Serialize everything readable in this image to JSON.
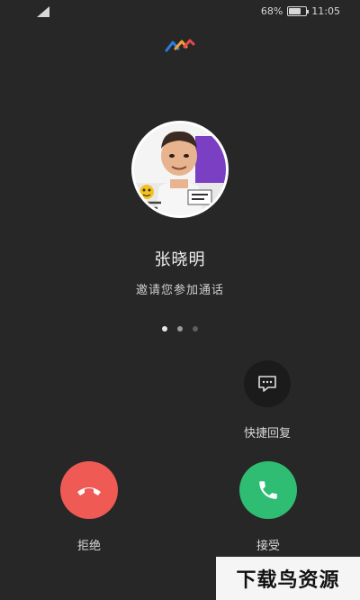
{
  "status_bar": {
    "battery_percent": "68%",
    "battery_level": 0.68,
    "time": "11:05"
  },
  "caller": {
    "name": "张晓明",
    "subtitle": "邀请您参加通话"
  },
  "pager": {
    "count": 3,
    "active_index": 0
  },
  "quick_reply": {
    "label": "快捷回复",
    "icon": "message-icon"
  },
  "actions": {
    "decline_label": "拒绝",
    "accept_label": "接受"
  },
  "watermark": {
    "text": "下载鸟资源"
  },
  "colors": {
    "background": "#272727",
    "decline": "#ef5a55",
    "accept": "#2ebd72",
    "logo_blue": "#2a7de1",
    "logo_orange": "#f2a03a",
    "logo_red": "#e84a4a"
  }
}
